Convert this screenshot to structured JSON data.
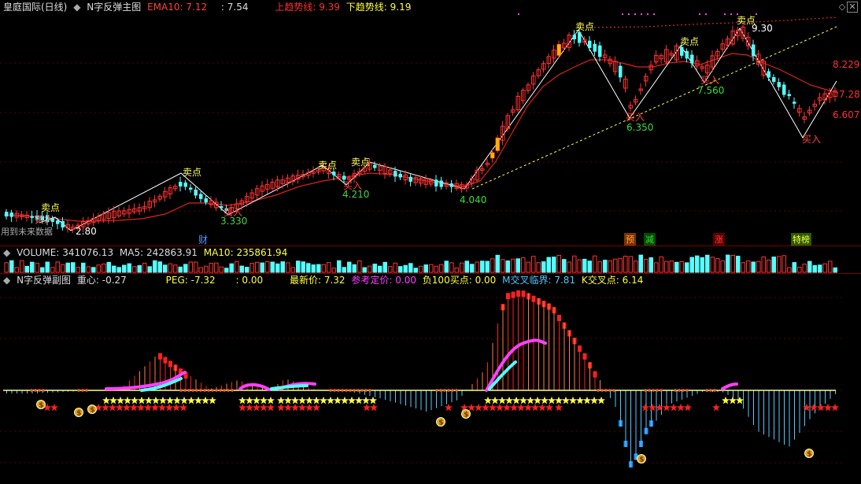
{
  "main": {
    "title": "皇庭国际(日线)",
    "indicator": "N字反弹主图",
    "ema_label": "EMA10:",
    "ema_value": "7.12",
    "blank_label": ":",
    "blank_value": "7.54",
    "up_label": "上趋势线:",
    "up_value": "9.39",
    "down_label": "下趋势线:",
    "down_value": "9.19",
    "note": "用到未来数据",
    "price_labels": {
      "p1": "2.80",
      "p2": "3.330",
      "p3": "4.210",
      "p4": "4.040",
      "p5": "6.350",
      "p6": "7.560",
      "p7": "9.30",
      "p8": "8.229",
      "p9": "7.281",
      "p10": "6.607"
    },
    "sell_label": "卖点",
    "buy_label": "买入",
    "events": {
      "cai": "财",
      "yu": "预",
      "jian": "减",
      "zhang": "涨",
      "te": "特榜"
    }
  },
  "volume": {
    "label": "VOLUME:",
    "value": "341076.13",
    "ma5_label": "MA5:",
    "ma5": "242863.91",
    "ma10_label": "MA10:",
    "ma10": "235861.94"
  },
  "sub": {
    "title": "N字反弹副图",
    "center_label": "重心:",
    "center": "-0.27",
    "peg_label": "PEG:",
    "peg": "-7.32",
    "blank_label": ":",
    "blank": "0.00",
    "latest_label": "最新价:",
    "latest": "7.32",
    "ref_label": "参考定价:",
    "ref": "0.00",
    "neg_label": "负100买点:",
    "neg": "0.00",
    "m_label": "M交叉临界:",
    "m": "7.81",
    "k_label": "K交叉点:",
    "k": "6.14"
  },
  "colors": {
    "bg": "#000000",
    "up": "#ff3232",
    "down": "#54ffff",
    "ema": "#e0201e",
    "sell": "#ffff54",
    "buy": "#ff5454",
    "green": "#00e600",
    "magenta": "#ff00ff",
    "yellow": "#ffff00",
    "blue": "#1e90ff"
  },
  "icons": [
    "collapse-icon",
    "maximize-icon",
    "money-bag-icon",
    "star-icon"
  ]
}
